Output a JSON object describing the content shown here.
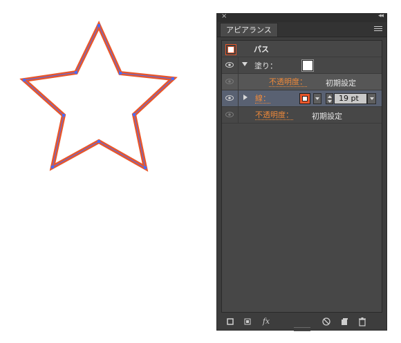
{
  "panel": {
    "close_glyph": "×",
    "collapse_glyph": "◂◂",
    "tab_label": "アピアランス",
    "menu_icon": "panel-menu-icon"
  },
  "appearance": {
    "object_label": "パス",
    "fill_label": "塗り：",
    "fill_opacity_label": "不透明度：",
    "fill_opacity_value": "初期設定",
    "stroke_label": "線：",
    "stroke_weight": "19 pt",
    "stroke_opacity_label": "不透明度：",
    "stroke_opacity_value": "初期設定"
  },
  "footer": {
    "fx_label": "fx"
  },
  "colors": {
    "stroke_accent": "#e8572b",
    "label_orange": "#f08a3a",
    "selection_blue": "#4a6cf7"
  }
}
